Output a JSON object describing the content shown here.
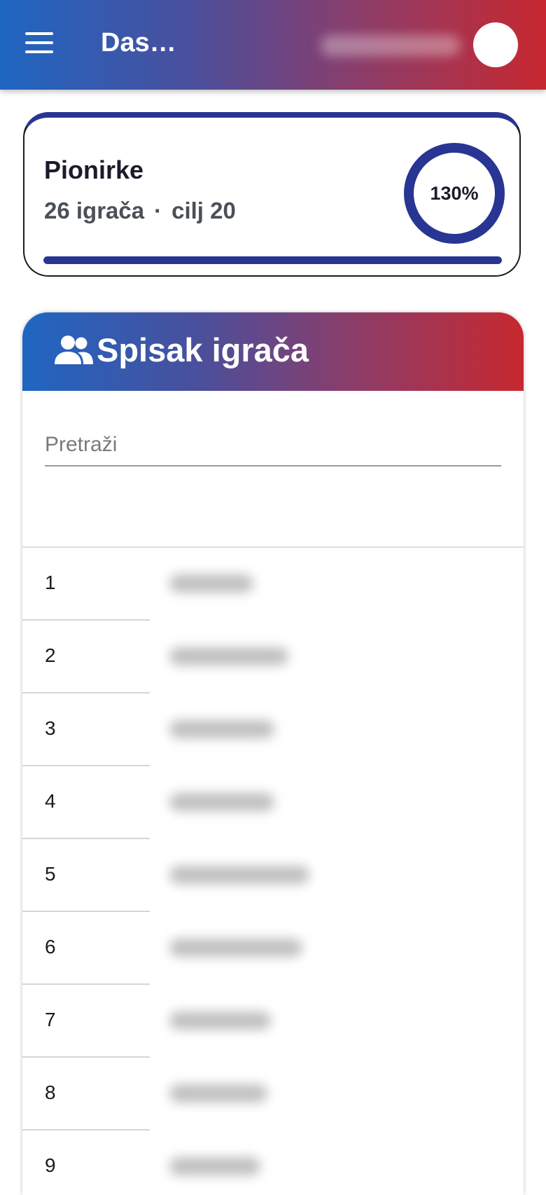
{
  "appbar": {
    "title": "Dashboard",
    "menu_icon": "hamburger-menu-icon"
  },
  "team_card": {
    "name": "Pionirke",
    "players_count": "26 igrača",
    "separator": "·",
    "goal": "cilj 20",
    "percent_label": "130%",
    "progress_fraction": 1.0,
    "accent_color": "#283593"
  },
  "players_panel": {
    "title": "Spisak igrača",
    "icon": "people-icon",
    "search_placeholder": "Pretraži",
    "rows": [
      {
        "number": "1"
      },
      {
        "number": "2"
      },
      {
        "number": "3"
      },
      {
        "number": "4"
      },
      {
        "number": "5"
      },
      {
        "number": "6"
      },
      {
        "number": "7"
      },
      {
        "number": "8"
      },
      {
        "number": "9"
      }
    ]
  },
  "colors": {
    "gradient_start": "#1f66c2",
    "gradient_end": "#c7282f",
    "primary": "#283593"
  }
}
